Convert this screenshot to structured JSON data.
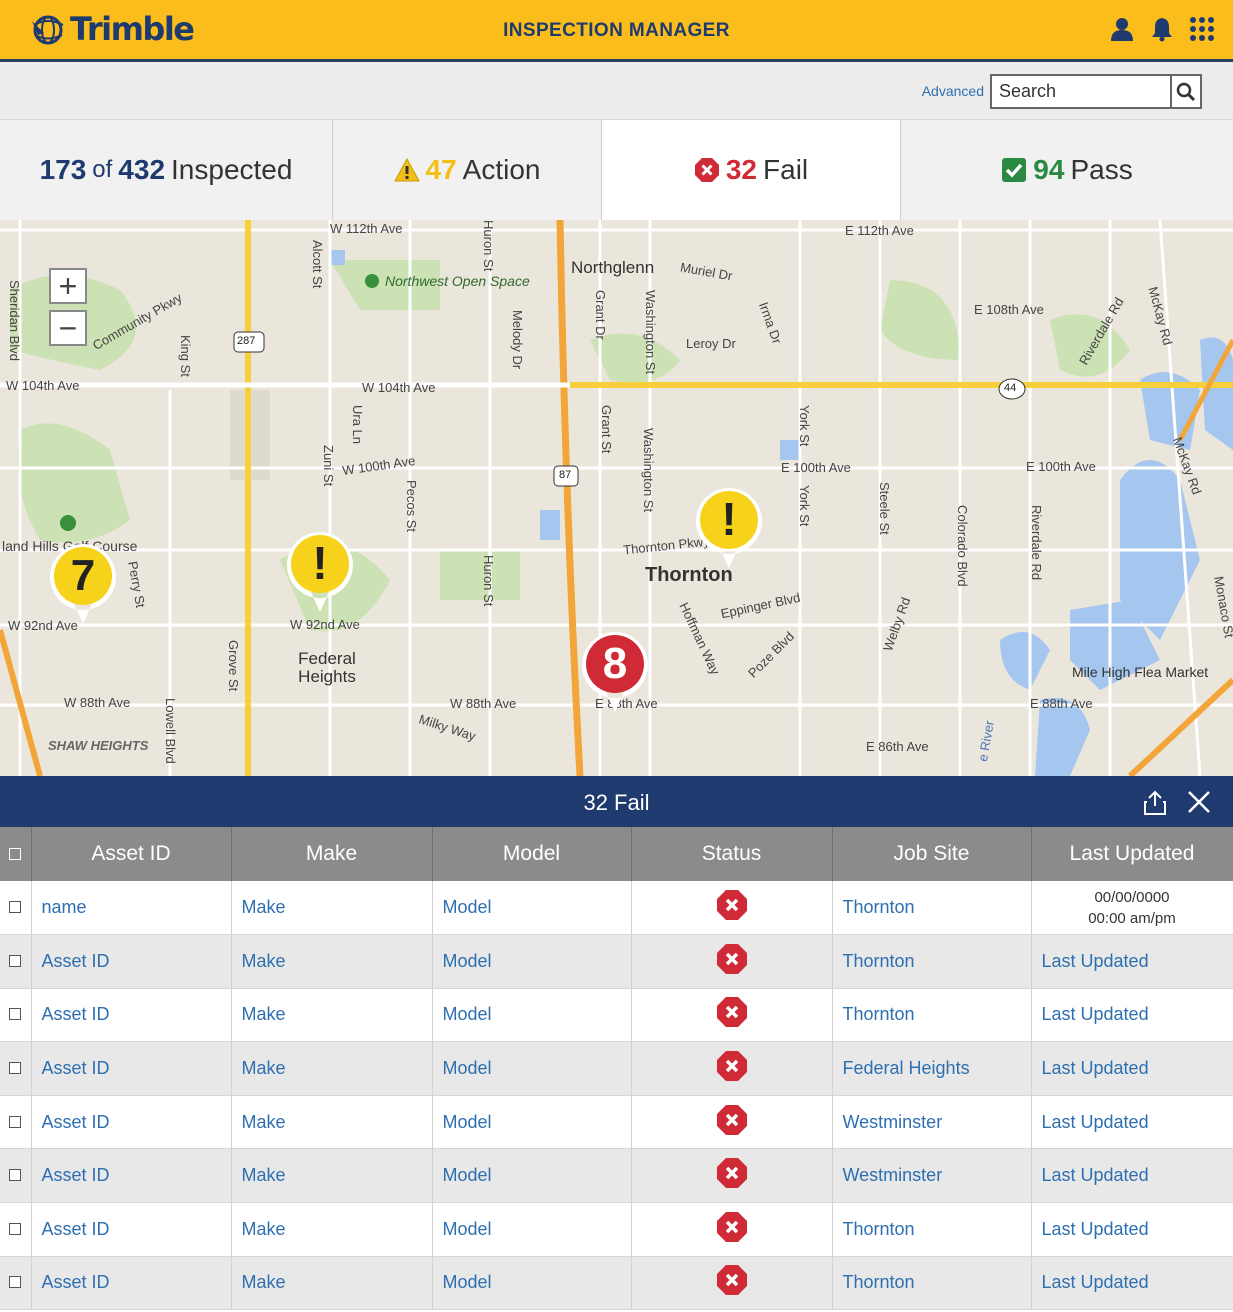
{
  "brand": {
    "name": "Trimble",
    "color": "#1f3a6e",
    "accent": "#fbbd1b"
  },
  "header": {
    "title": "INSPECTION MANAGER",
    "icons": [
      "user-icon",
      "bell-icon",
      "apps-grid-icon"
    ]
  },
  "search": {
    "advanced_label": "Advanced",
    "placeholder": "Search"
  },
  "summary": {
    "inspected_count": "173",
    "of_label": "of",
    "total": "432",
    "inspected_label": "Inspected",
    "action_count": "47",
    "action_label": "Action",
    "fail_count": "32",
    "fail_label": "Fail",
    "pass_count": "94",
    "pass_label": "Pass",
    "colors": {
      "action": "#f3bf16",
      "fail": "#cf2a35",
      "pass": "#2a8a43"
    }
  },
  "map": {
    "zoom_in": "+",
    "zoom_out": "−",
    "labels": {
      "w112": "W 112th Ave",
      "e112": "E 112th Ave",
      "northglenn": "Northglenn",
      "muriel": "Muriel Dr",
      "nw_open": "Northwest Open Space",
      "community": "Community Pkwy",
      "king": "King St",
      "alcott": "Alcott St",
      "huron1": "Huron St",
      "melody": "Melody Dr",
      "grant1": "Grant Dr",
      "wash1": "Washington St",
      "irma": "Irma Dr",
      "leroy": "Leroy Dr",
      "e108": "E 108th Ave",
      "riverdale1": "Riverdale Rd",
      "mckay1": "McKay Rd",
      "sheridan": "Sheridan Blvd",
      "w104a": "W 104th Ave",
      "w104b": "W 104th Ave",
      "hwy287": "287",
      "hwy87": "87",
      "hwy44": "44",
      "ura": "Ura Ln",
      "zuni": "Zuni St",
      "w100": "W 100th Ave",
      "pecos": "Pecos St",
      "grant2": "Grant St",
      "wash2": "Washington St",
      "york1": "York St",
      "york2": "York St",
      "e100a": "E 100th Ave",
      "e100b": "E 100th Ave",
      "steele": "Steele St",
      "colorado": "Colorado Blvd",
      "riverdale2": "Riverdale Rd",
      "mckay2": "McKay Rd",
      "golf": "land Hills Golf Course",
      "perry": "Perry St",
      "huron2": "Huron St",
      "thornton_pkwy": "Thornton Pkwy",
      "thornton": "Thornton",
      "eppinger": "Eppinger Blvd",
      "hoffman": "Hoffman Way",
      "poze": "Poze Blvd",
      "welby": "Welby Rd",
      "monaco": "Monaco St",
      "w92a": "W 92nd Ave",
      "w92b": "W 92nd Ave",
      "federal": "Federal Heights",
      "grove": "Grove St",
      "w88a": "W 88th Ave",
      "w88b": "W 88th Ave",
      "e88a": "E 88th Ave",
      "e88b": "E 88th Ave",
      "lowell": "Lowell Blvd",
      "milky": "Milky Way",
      "shaw": "SHAW HEIGHTS",
      "e86": "E 86th Ave",
      "flea": "Mile High Flea Market",
      "river": "e River"
    },
    "markers": [
      {
        "type": "cluster-action",
        "count": "7"
      },
      {
        "type": "action",
        "glyph": "!"
      },
      {
        "type": "action",
        "glyph": "!"
      },
      {
        "type": "cluster-fail",
        "count": "8"
      }
    ]
  },
  "panel": {
    "title": "32 Fail",
    "columns": [
      "Asset ID",
      "Make",
      "Model",
      "Status",
      "Job Site",
      "Last Updated"
    ],
    "rows": [
      {
        "asset": "name",
        "make": "Make",
        "model": "Model",
        "site": "Thornton",
        "updated_date": "00/00/0000",
        "updated_time": "00:00 am/pm"
      },
      {
        "asset": "Asset ID",
        "make": "Make",
        "model": "Model",
        "site": "Thornton",
        "updated": "Last Updated"
      },
      {
        "asset": "Asset ID",
        "make": "Make",
        "model": "Model",
        "site": "Thornton",
        "updated": "Last Updated"
      },
      {
        "asset": "Asset ID",
        "make": "Make",
        "model": "Model",
        "site": "Federal Heights",
        "updated": "Last Updated"
      },
      {
        "asset": "Asset ID",
        "make": "Make",
        "model": "Model",
        "site": "Westminster",
        "updated": "Last Updated"
      },
      {
        "asset": "Asset ID",
        "make": "Make",
        "model": "Model",
        "site": "Westminster",
        "updated": "Last Updated"
      },
      {
        "asset": "Asset ID",
        "make": "Make",
        "model": "Model",
        "site": "Thornton",
        "updated": "Last Updated"
      },
      {
        "asset": "Asset ID",
        "make": "Make",
        "model": "Model",
        "site": "Thornton",
        "updated": "Last Updated"
      }
    ]
  }
}
